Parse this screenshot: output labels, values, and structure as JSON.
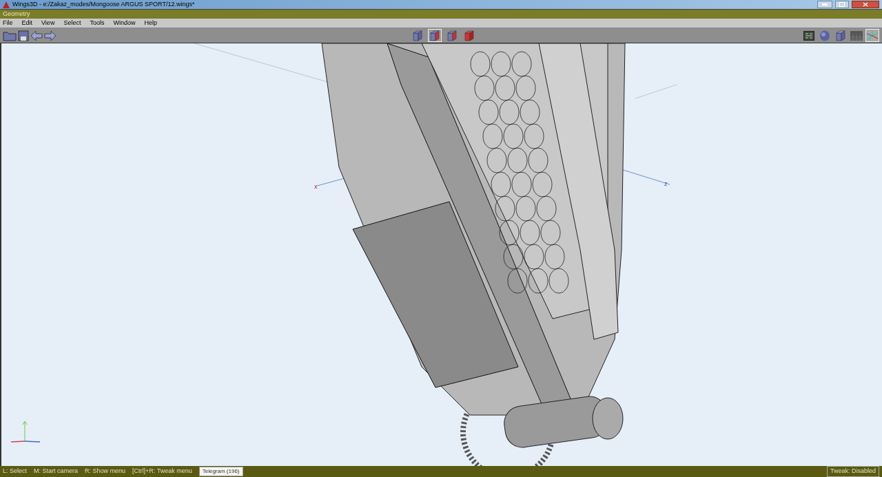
{
  "window": {
    "title": "Wings3D - e:/Zakaz_modes/Mongoose ARGUS SPORT/12.wings*"
  },
  "panel": {
    "title": "Geometry"
  },
  "menu": [
    "File",
    "Edit",
    "View",
    "Select",
    "Tools",
    "Window",
    "Help"
  ],
  "selection_modes": [
    {
      "kind": "vertex",
      "selected": false
    },
    {
      "kind": "edge",
      "selected": true
    },
    {
      "kind": "face",
      "selected": false
    },
    {
      "kind": "body",
      "selected": false
    }
  ],
  "view_modes": [
    {
      "kind": "grid",
      "selected": false
    },
    {
      "kind": "smooth",
      "selected": false
    },
    {
      "kind": "wire",
      "selected": false
    },
    {
      "kind": "ground",
      "selected": false
    },
    {
      "kind": "axes",
      "selected": true
    }
  ],
  "viewport": {
    "axis_labels": [
      {
        "kind": "x",
        "text": "x"
      },
      {
        "kind": "z",
        "text": "z"
      }
    ]
  },
  "status_bar": {
    "hints": [
      "L: Select",
      "M: Start camera",
      "R: Show menu",
      "[Ctrl]+R: Tweak menu"
    ],
    "telegram": "Telegram (196)",
    "tweak": "Tweak: Disabled"
  }
}
